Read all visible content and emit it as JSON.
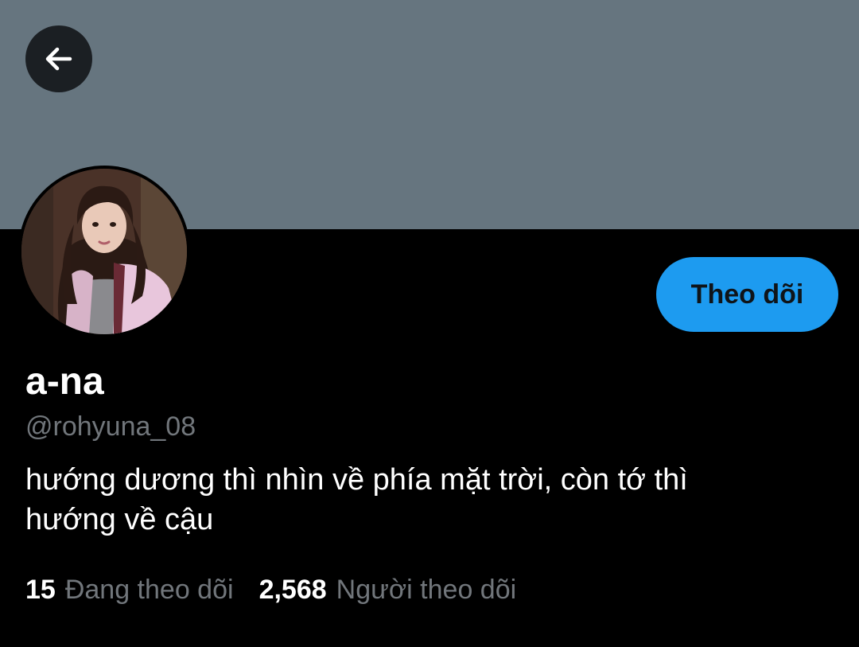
{
  "profile": {
    "display_name": "a-na",
    "handle": "@rohyuna_08",
    "bio_line1": "hướng dương thì nhìn về phía mặt trời, còn tớ thì",
    "bio_line2": "hướng về cậu"
  },
  "actions": {
    "follow_label": "Theo dõi"
  },
  "stats": {
    "following_count": "15",
    "following_label": "Đang theo dõi",
    "followers_count": "2,568",
    "followers_label": "Người theo dõi"
  },
  "icons": {
    "back": "arrow-left-icon"
  },
  "colors": {
    "banner": "#66757f",
    "background": "#000000",
    "accent": "#1d9bf0",
    "secondary_text": "#71767b"
  }
}
